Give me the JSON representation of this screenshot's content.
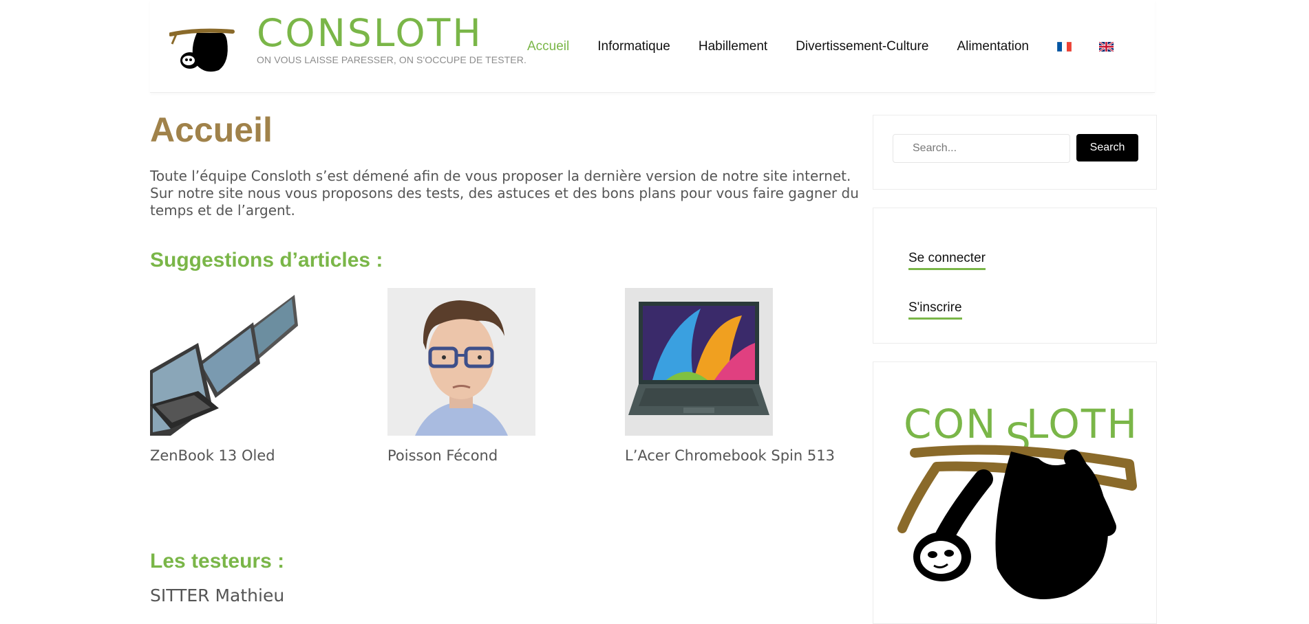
{
  "brand": {
    "name": "CONSLOTH",
    "tagline": "ON VOUS LAISSE PARESSER, ON S'OCCUPE DE TESTER."
  },
  "nav": {
    "items": [
      "Accueil",
      "Informatique",
      "Habillement",
      "Divertissement-Culture",
      "Alimentation"
    ],
    "active": "Accueil",
    "languages": [
      "fr-flag-icon",
      "uk-flag-icon"
    ]
  },
  "page": {
    "title": "Accueil",
    "intro": [
      "Toute l’équipe Consloth s’est démené afin de vous proposer la dernière version de notre site internet.",
      "Sur notre site nous vous proposons des tests, des astuces et des bons plans pour vous faire gagner du",
      "temps et de l’argent."
    ],
    "suggestions_title": "Suggestions d’articles :",
    "articles": [
      {
        "title": "ZenBook 13 Oled",
        "image": "laptops-tent-mode-image"
      },
      {
        "title": "Poisson Fécond",
        "image": "man-with-glasses-portrait"
      },
      {
        "title": "L’Acer Chromebook Spin 513",
        "image": "zenbook-laptop-image"
      }
    ],
    "testers_title": "Les testeurs :",
    "testers": [
      "SITTER Mathieu"
    ]
  },
  "sidebar": {
    "search": {
      "placeholder": "Search...",
      "button": "Search"
    },
    "auth": {
      "login": "Se connecter",
      "register": "S'inscrire"
    }
  },
  "colors": {
    "accent": "#7ab648",
    "title": "#a0824a",
    "text": "#555555"
  }
}
